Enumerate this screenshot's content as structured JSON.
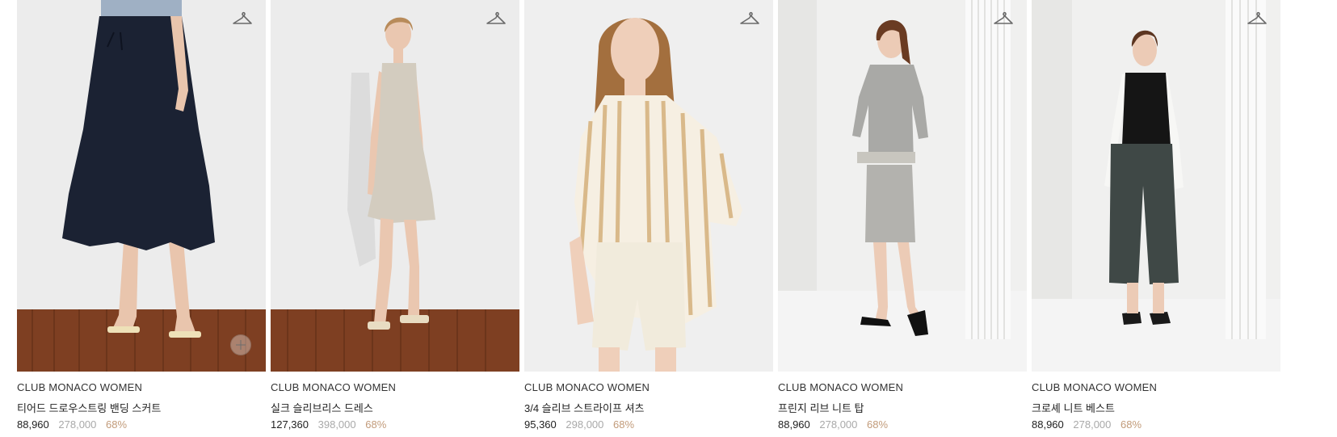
{
  "products": [
    {
      "brand": "CLUB MONACO WOMEN",
      "name": "티어드 드로우스트링 밴딩 스커트",
      "sale_price": "88,960",
      "original_price": "278,000",
      "discount": "68%",
      "image_alt": "woman in navy tiered drawstring skirt on wood floor",
      "colors": {
        "wall": "#eeeeee",
        "garment": "#1b2233",
        "floor": "#7e3f22"
      },
      "icons": [
        "hanger-icon",
        "plus-icon"
      ]
    },
    {
      "brand": "CLUB MONACO WOMEN",
      "name": "실크 슬리브리스 드레스",
      "sale_price": "127,360",
      "original_price": "398,000",
      "discount": "68%",
      "image_alt": "woman in beige silk sleeveless dress on wood floor",
      "colors": {
        "wall": "#eeeeee",
        "garment": "#d3ccbf",
        "floor": "#7e3f22"
      },
      "icons": [
        "hanger-icon"
      ]
    },
    {
      "brand": "CLUB MONACO WOMEN",
      "name": "3/4 슬리브 스트라이프 셔츠",
      "sale_price": "95,360",
      "original_price": "298,000",
      "discount": "68%",
      "image_alt": "woman in striped shirt and white shorts",
      "colors": {
        "wall": "#efefef",
        "garment": "#e5d3b4",
        "floor": "#efefef"
      },
      "icons": [
        "hanger-icon"
      ]
    },
    {
      "brand": "CLUB MONACO WOMEN",
      "name": "프린지 리브 니트 탑",
      "sale_price": "88,960",
      "original_price": "278,000",
      "discount": "68%",
      "image_alt": "woman in grey rib knit top and skirt",
      "colors": {
        "wall": "#f0f0ef",
        "garment": "#a9a9a6",
        "floor": "#f2f2f2"
      },
      "icons": [
        "hanger-icon"
      ]
    },
    {
      "brand": "CLUB MONACO WOMEN",
      "name": "크로셰 니트 베스트",
      "sale_price": "88,960",
      "original_price": "278,000",
      "discount": "68%",
      "image_alt": "woman in black crochet knit vest and grey trousers",
      "colors": {
        "wall": "#f0f0ef",
        "garment": "#3f4846",
        "floor": "#f2f2f2"
      },
      "icons": [
        "hanger-icon"
      ]
    }
  ]
}
